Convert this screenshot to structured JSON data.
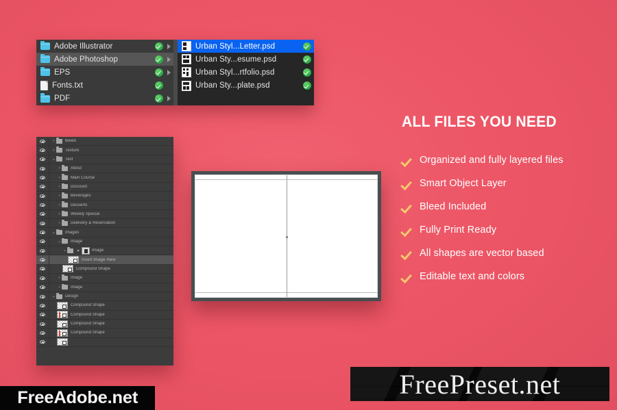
{
  "theme": {
    "background": "#ec5565",
    "panel_dark": "#3a3a3a",
    "panel_darker": "#262626",
    "selection_blue": "#0a63f0",
    "check_green": "#28a745",
    "check_amber": "#f6c96c",
    "folder_blue": "#4fc3e8"
  },
  "finder": {
    "left_column": [
      {
        "label": "Adobe Illustrator",
        "icon": "folder-icon",
        "badge": "check-badge-icon",
        "arrow": true,
        "selected": false
      },
      {
        "label": "Adobe Photoshop",
        "icon": "folder-icon",
        "badge": "check-badge-icon",
        "arrow": true,
        "selected": true
      },
      {
        "label": "EPS",
        "icon": "folder-icon",
        "badge": "check-badge-icon",
        "arrow": true,
        "selected": false
      },
      {
        "label": "Fonts.txt",
        "icon": "text-document-icon",
        "badge": "check-badge-icon",
        "arrow": false,
        "selected": false
      },
      {
        "label": "PDF",
        "icon": "folder-icon",
        "badge": "check-badge-icon",
        "arrow": true,
        "selected": false
      }
    ],
    "right_column": [
      {
        "label": "Urban Styl...Letter.psd",
        "icon": "psd-file-icon",
        "badge": "check-badge-icon",
        "selected": true
      },
      {
        "label": "Urban Sty...esume.psd",
        "icon": "psd-file-icon",
        "badge": "check-badge-icon",
        "selected": false
      },
      {
        "label": "Urban Styl...rtfolio.psd",
        "icon": "psd-file-icon",
        "badge": "check-badge-icon",
        "selected": false
      },
      {
        "label": "Urban Sty...plate.psd",
        "icon": "psd-file-icon",
        "badge": "check-badge-icon",
        "selected": false
      }
    ]
  },
  "layers": [
    {
      "label": "Bleed",
      "kind": "folder",
      "indent": 0,
      "tri": "›",
      "selected": false
    },
    {
      "label": "Texture",
      "kind": "folder",
      "indent": 0,
      "tri": "›",
      "selected": false
    },
    {
      "label": "Text",
      "kind": "folder",
      "indent": 0,
      "tri": "⌄",
      "selected": false
    },
    {
      "label": "About",
      "kind": "folder",
      "indent": 1,
      "tri": "›",
      "selected": false
    },
    {
      "label": "Main Course",
      "kind": "folder",
      "indent": 1,
      "tri": "›",
      "selected": false
    },
    {
      "label": "Discount",
      "kind": "folder",
      "indent": 1,
      "tri": "›",
      "selected": false
    },
    {
      "label": "Beverages",
      "kind": "folder",
      "indent": 1,
      "tri": "›",
      "selected": false
    },
    {
      "label": "Desserts",
      "kind": "folder",
      "indent": 1,
      "tri": "›",
      "selected": false
    },
    {
      "label": "Weekly Special",
      "kind": "folder",
      "indent": 1,
      "tri": "›",
      "selected": false
    },
    {
      "label": "Delevery & Reservation",
      "kind": "folder",
      "indent": 1,
      "tri": "›",
      "selected": false
    },
    {
      "label": "Images",
      "kind": "folder",
      "indent": 0,
      "tri": "⌄",
      "selected": false
    },
    {
      "label": "Image",
      "kind": "folder",
      "indent": 1,
      "tri": "⌄",
      "selected": false
    },
    {
      "label": "Image",
      "kind": "smart",
      "indent": 2,
      "tri": "⌄",
      "selected": false
    },
    {
      "label": "Insert Image Here",
      "kind": "thumb",
      "indent": 3,
      "tri": "",
      "selected": true
    },
    {
      "label": "Compound Shape",
      "kind": "thumb",
      "indent": 2,
      "tri": "",
      "selected": false
    },
    {
      "label": "Image",
      "kind": "folder",
      "indent": 1,
      "tri": "›",
      "selected": false
    },
    {
      "label": "Image",
      "kind": "folder",
      "indent": 1,
      "tri": "›",
      "selected": false
    },
    {
      "label": "Design",
      "kind": "folder",
      "indent": 0,
      "tri": "⌄",
      "selected": false
    },
    {
      "label": "Compound Shape",
      "kind": "thumb",
      "indent": 1,
      "tri": "",
      "selected": false
    },
    {
      "label": "Compound Shape",
      "kind": "thumb-red",
      "indent": 1,
      "tri": "",
      "selected": false
    },
    {
      "label": "Compound Shape",
      "kind": "thumb",
      "indent": 1,
      "tri": "",
      "selected": false
    },
    {
      "label": "Compound Shape",
      "kind": "thumb-red",
      "indent": 1,
      "tri": "",
      "selected": false
    },
    {
      "label": "",
      "kind": "thumb",
      "indent": 1,
      "tri": "",
      "selected": false
    }
  ],
  "features": {
    "title": "ALL FILES YOU NEED",
    "items": [
      "Organized and fully layered files",
      "Smart Object Layer",
      "Bleed Included",
      "Fully Print Ready",
      "All shapes are vector based",
      "Editable text and colors"
    ]
  },
  "watermarks": {
    "left": "FreeAdobe.net",
    "right": "FreePreset.net"
  }
}
